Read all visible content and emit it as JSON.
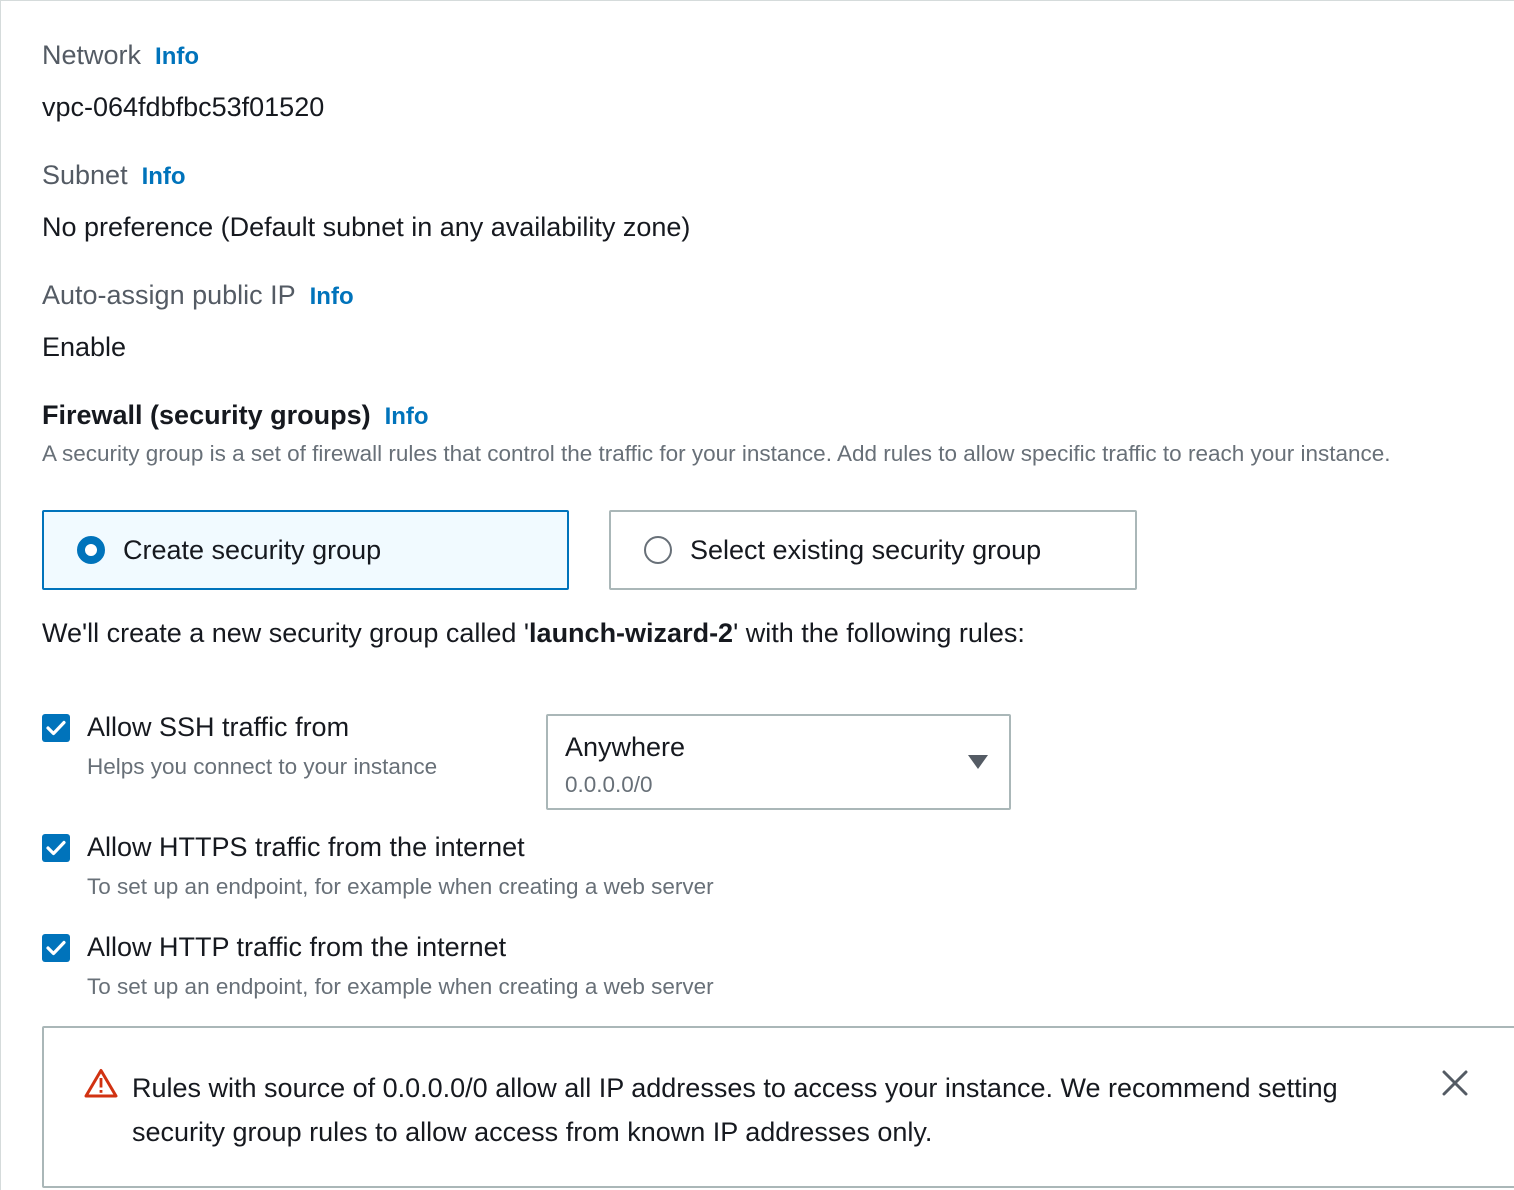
{
  "network": {
    "label": "Network",
    "info": "Info",
    "value": "vpc-064fdbfbc53f01520"
  },
  "subnet": {
    "label": "Subnet",
    "info": "Info",
    "value": "No preference (Default subnet in any availability zone)"
  },
  "auto_assign": {
    "label": "Auto-assign public IP",
    "info": "Info",
    "value": "Enable"
  },
  "firewall": {
    "title": "Firewall (security groups)",
    "info": "Info",
    "description": "A security group is a set of firewall rules that control the traffic for your instance. Add rules to allow specific traffic to reach your instance.",
    "options": [
      {
        "label": "Create security group",
        "selected": true
      },
      {
        "label": "Select existing security group",
        "selected": false
      }
    ],
    "create_prefix": "We'll create a new security group called '",
    "group_name": "launch-wizard-2",
    "create_suffix": "' with the following rules:"
  },
  "rules": [
    {
      "title": "Allow SSH traffic from",
      "subtitle": "Helps you connect to your instance",
      "checked": true
    },
    {
      "title": "Allow HTTPS traffic from the internet",
      "subtitle": "To set up an endpoint, for example when creating a web server",
      "checked": true
    },
    {
      "title": "Allow HTTP traffic from the internet",
      "subtitle": "To set up an endpoint, for example when creating a web server",
      "checked": true
    }
  ],
  "ssh_source": {
    "value": "Anywhere",
    "detail": "0.0.0.0/0",
    "icon": "caret-down-icon"
  },
  "warning": {
    "icon": "warning-triangle-icon",
    "text": "Rules with source of 0.0.0.0/0 allow all IP addresses to access your instance. We recommend setting security group rules to allow access from known IP addresses only.",
    "close_icon": "close-icon"
  },
  "colors": {
    "accent": "#0073bb",
    "warning": "#d13212",
    "selected_bg": "#f1faff"
  }
}
